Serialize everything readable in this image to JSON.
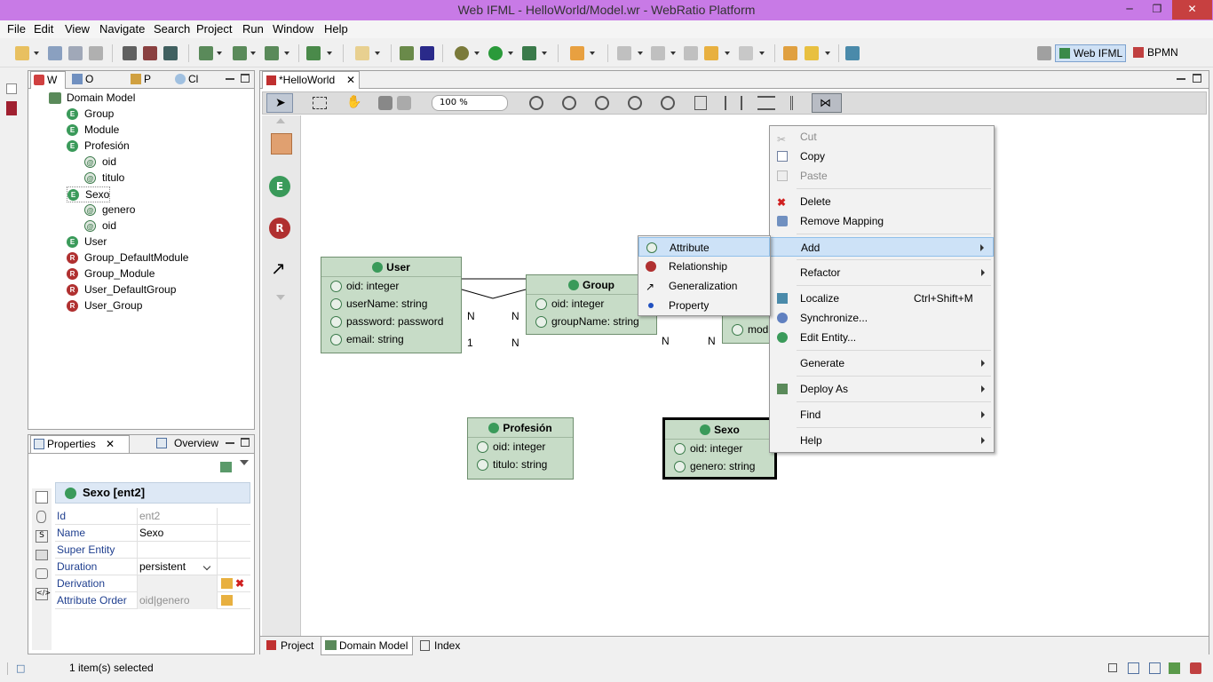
{
  "window": {
    "title": "Web IFML - HelloWorld/Model.wr - WebRatio Platform",
    "minimize": "─",
    "maximize": "❐",
    "close": "✕"
  },
  "menu": [
    "File",
    "Edit",
    "View",
    "Navigate",
    "Search",
    "Project",
    "Run",
    "Window",
    "Help"
  ],
  "perspectives": {
    "web_ifml": "Web IFML",
    "bpmn": "BPMN"
  },
  "outline": {
    "tabs": [
      "W",
      "O",
      "P",
      "Cl"
    ],
    "tree": [
      {
        "label": "Domain Model",
        "type": "dm",
        "level": 0
      },
      {
        "label": "Group",
        "type": "E",
        "level": 1
      },
      {
        "label": "Module",
        "type": "E",
        "level": 1
      },
      {
        "label": "Profesión",
        "type": "E",
        "level": 1
      },
      {
        "label": "oid",
        "type": "A",
        "level": 2
      },
      {
        "label": "titulo",
        "type": "A",
        "level": 2
      },
      {
        "label": "Sexo",
        "type": "E",
        "level": 1
      },
      {
        "label": "genero",
        "type": "A",
        "level": 2
      },
      {
        "label": "oid",
        "type": "A",
        "level": 2
      },
      {
        "label": "User",
        "type": "E",
        "level": 1
      },
      {
        "label": "Group_DefaultModule",
        "type": "R",
        "level": 1
      },
      {
        "label": "Group_Module",
        "type": "R",
        "level": 1
      },
      {
        "label": "User_DefaultGroup",
        "type": "R",
        "level": 1
      },
      {
        "label": "User_Group",
        "type": "R",
        "level": 1
      }
    ]
  },
  "properties": {
    "tab": "Properties",
    "tab2": "Overview",
    "header": "Sexo [ent2]",
    "rows": [
      {
        "key": "Id",
        "value": "ent2"
      },
      {
        "key": "Name",
        "value": "Sexo"
      },
      {
        "key": "Super Entity",
        "value": ""
      },
      {
        "key": "Duration",
        "value": "persistent"
      },
      {
        "key": "Derivation",
        "value": ""
      },
      {
        "key": "Attribute Order",
        "value": "oid|genero"
      }
    ]
  },
  "editor": {
    "tab": "*HelloWorld",
    "zoom": "100 %",
    "bottom_tabs": [
      "Project",
      "Domain Model",
      "Index"
    ],
    "palette": [
      "E",
      "R"
    ]
  },
  "entities": {
    "user": {
      "title": "User",
      "attrs": [
        "oid: integer",
        "userName: string",
        "password: password",
        "email: string"
      ]
    },
    "group": {
      "title": "Group",
      "attrs": [
        "oid: integer",
        "groupName: string"
      ]
    },
    "module": {
      "attr": "mod"
    },
    "profesion": {
      "title": "Profesión",
      "attrs": [
        "oid: integer",
        "titulo: string"
      ]
    },
    "sexo": {
      "title": "Sexo",
      "attrs": [
        "oid: integer",
        "genero: string"
      ]
    }
  },
  "relation_labels": {
    "n1": "N",
    "n2": "N",
    "one": "1",
    "n3": "N",
    "n4": "N",
    "n5": "N"
  },
  "context_menu": {
    "cut": "Cut",
    "copy": "Copy",
    "paste": "Paste",
    "delete": "Delete",
    "remove_mapping": "Remove Mapping",
    "add": "Add",
    "refactor": "Refactor",
    "localize": "Localize",
    "localize_shortcut": "Ctrl+Shift+M",
    "synchronize": "Synchronize...",
    "edit_entity": "Edit Entity...",
    "generate": "Generate",
    "deploy_as": "Deploy As",
    "find": "Find",
    "help": "Help"
  },
  "add_submenu": {
    "attribute": "Attribute",
    "relationship": "Relationship",
    "generalization": "Generalization",
    "property": "Property"
  },
  "status": {
    "selected": "1 item(s) selected"
  }
}
